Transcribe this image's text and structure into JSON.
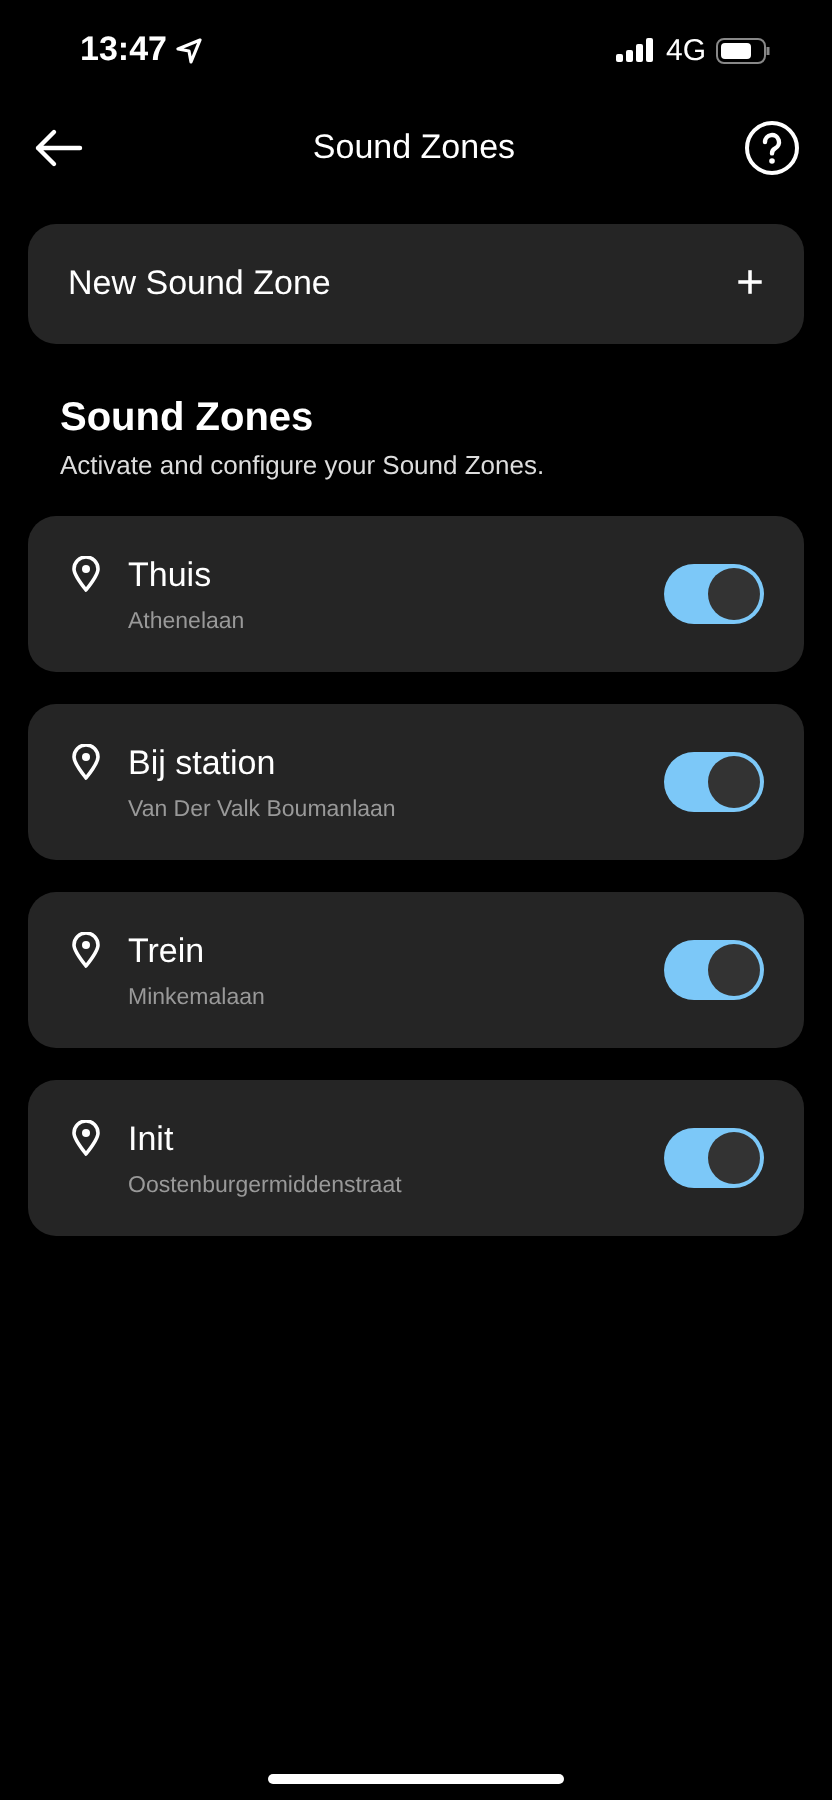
{
  "status_bar": {
    "time": "13:47",
    "network": "4G"
  },
  "header": {
    "title": "Sound Zones"
  },
  "new_zone": {
    "label": "New Sound Zone",
    "icon": "+"
  },
  "section": {
    "title": "Sound Zones",
    "subtitle": "Activate and configure your Sound Zones."
  },
  "zones": [
    {
      "name": "Thuis",
      "address": "Athenelaan",
      "on": true
    },
    {
      "name": "Bij station",
      "address": "Van Der Valk Boumanlaan",
      "on": true
    },
    {
      "name": "Trein",
      "address": "Minkemalaan",
      "on": true
    },
    {
      "name": "Init",
      "address": "Oostenburgermiddenstraat",
      "on": true
    }
  ]
}
